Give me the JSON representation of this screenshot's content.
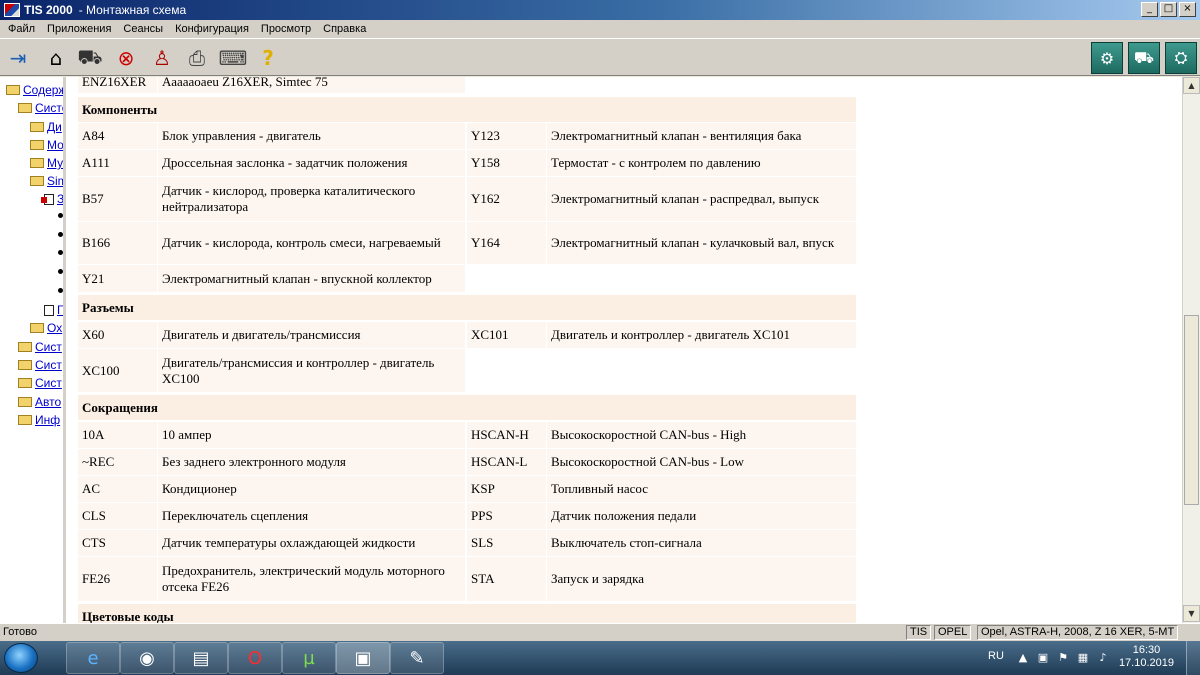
{
  "window": {
    "title": "TIS 2000",
    "subtitle": "- Монтажная схема",
    "min": "_",
    "max": "□",
    "close": "×"
  },
  "menu": [
    "Файл",
    "Приложения",
    "Сеансы",
    "Конфигурация",
    "Просмотр",
    "Справка"
  ],
  "tree": [
    {
      "label": "Содерж",
      "link": true
    },
    {
      "label": "Систе",
      "link": true
    },
    {
      "label": "Ди",
      "link": true
    },
    {
      "label": "Мо",
      "link": true
    },
    {
      "label": "Му",
      "link": true
    },
    {
      "label": "Sim",
      "link": true
    },
    {
      "label": "З",
      "link": true
    },
    {
      "label": "Г",
      "link": true
    },
    {
      "label": "Ох",
      "link": true
    },
    {
      "label": "Сист",
      "link": true
    },
    {
      "label": "Сист",
      "link": true
    },
    {
      "label": "Сист",
      "link": true
    },
    {
      "label": "Авто",
      "link": true
    },
    {
      "label": "Инф",
      "link": true
    }
  ],
  "content": {
    "top_row": {
      "code": "ENZ16XER",
      "desc": "Аааааоаеu Z16XER, Simtec 75"
    },
    "sections": {
      "components": "Компоненты",
      "connectors": "Разъемы",
      "abbreviations": "Сокращения",
      "colors": "Цветовые коды"
    },
    "components": [
      [
        "A84",
        "Блок управления - двигатель",
        "Y123",
        "Электромагнитный клапан - вентиляция бака"
      ],
      [
        "A111",
        "Дроссельная заслонка - задатчик положения",
        "Y158",
        "Термостат - с контролем по давлению"
      ],
      [
        "B57",
        "Датчик - кислород, проверка каталитического нейтрализатора",
        "Y162",
        "Электромагнитный клапан - распредвал, выпуск"
      ],
      [
        "B166",
        "Датчик - кислорода, контроль смеси, нагреваемый",
        "Y164",
        "Электромагнитный клапан - кулачковый вал, впуск"
      ],
      [
        "Y21",
        "Электромагнитный клапан - впускной коллектор",
        "",
        ""
      ]
    ],
    "connectors": [
      [
        "X60",
        "Двигатель и двигатель/трансмиссия",
        "XC101",
        "Двигатель и контроллер - двигатель XC101"
      ],
      [
        "XC100",
        "Двигатель/трансмиссия и контроллер - двигатель XC100",
        "",
        ""
      ]
    ],
    "abbreviations": [
      [
        "10A",
        "10 ампер",
        "HSCAN-H",
        "Высокоскоростной CAN-bus - High"
      ],
      [
        "~REC",
        "Без заднего электронного модуля",
        "HSCAN-L",
        "Высокоскоростной CAN-bus - Low"
      ],
      [
        "AC",
        "Кондиционер",
        "KSP",
        "Топливный насос"
      ],
      [
        "CLS",
        "Переключатель сцепления",
        "PPS",
        "Датчик положения педали"
      ],
      [
        "CTS",
        "Датчик температуры охлаждающей жидкости",
        "SLS",
        "Выключатель стоп-сигнала"
      ],
      [
        "FE26",
        "Предохранитель, электрический модуль моторного отсека FE26",
        "STA",
        "Запуск и зарядка"
      ]
    ]
  },
  "status": {
    "ready": "Готово",
    "app": "TIS",
    "brand": "OPEL",
    "vehicle": "Opel, ASTRA-H, 2008, Z 16 XER, 5-MT"
  },
  "taskbar": {
    "lang": "RU",
    "time": "16:30",
    "date": "17.10.2019"
  },
  "colors": {
    "section_bg": "#fbeee3",
    "cell_bg": "#fdf6f0",
    "link": "#0000cc"
  }
}
